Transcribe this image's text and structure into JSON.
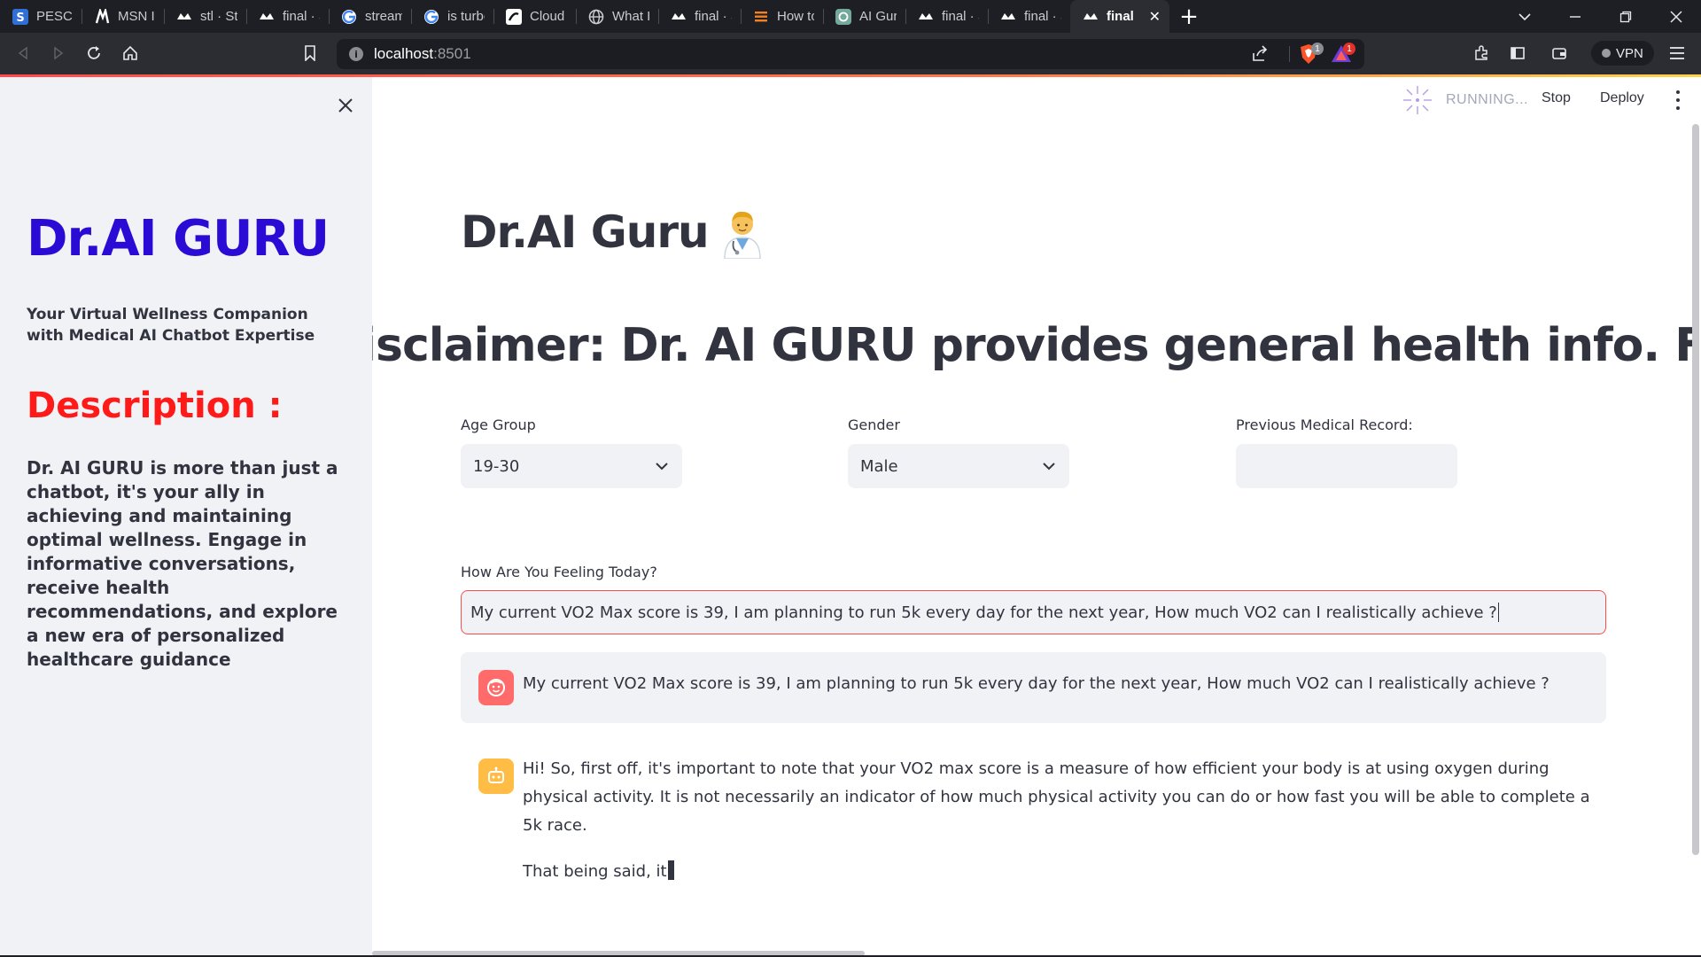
{
  "browser": {
    "tabs": [
      {
        "title": "PESCE Cap",
        "icon": "s-logo-icon",
        "active": false
      },
      {
        "title": "MSN India",
        "icon": "msn-icon",
        "active": false
      },
      {
        "title": "stl · Stream",
        "icon": "streamlit-icon",
        "active": false
      },
      {
        "title": "final · Stre",
        "icon": "streamlit-icon",
        "active": false
      },
      {
        "title": "stream lit",
        "icon": "google-icon",
        "active": false
      },
      {
        "title": "is turbo fa",
        "icon": "google-icon",
        "active": false
      },
      {
        "title": "Cloud App",
        "icon": "cloud-app-icon",
        "active": false
      },
      {
        "title": "What Is M",
        "icon": "globe-icon",
        "active": false
      },
      {
        "title": "final · Stre",
        "icon": "streamlit-icon",
        "active": false
      },
      {
        "title": "How to tra",
        "icon": "stackoverflow-icon",
        "active": false
      },
      {
        "title": "AI Guru Tr",
        "icon": "chatgpt-icon",
        "active": false
      },
      {
        "title": "final · Stre",
        "icon": "streamlit-icon",
        "active": false
      },
      {
        "title": "final · Stre",
        "icon": "streamlit-icon",
        "active": false
      },
      {
        "title": "final ·",
        "icon": "streamlit-icon",
        "active": true
      }
    ],
    "url_host": "localhost",
    "url_port": ":8501",
    "shield_count": "1",
    "alert_count": "1",
    "vpn_label": "VPN"
  },
  "sidebar": {
    "title": "Dr.AI GURU",
    "subtitle": "Your Virtual Wellness Companion with Medical AI Chatbot Expertise",
    "description_heading": "Description :",
    "description": "Dr. AI GURU is more than just a chatbot, it's your ally in achieving and maintaining optimal wellness. Engage in informative conversations, receive health recommendations, and explore a new era of personalized healthcare guidance"
  },
  "header": {
    "running_label": "RUNNING...",
    "stop_label": "Stop",
    "deploy_label": "Deploy"
  },
  "main": {
    "title": "Dr.AI Guru",
    "title_emoji": "doctor-emoji",
    "disclaimer": "Disclaimer: Dr. AI GURU provides general health info. For personal",
    "age_group": {
      "label": "Age Group",
      "value": "19-30"
    },
    "gender": {
      "label": "Gender",
      "value": "Male"
    },
    "medical_record": {
      "label": "Previous Medical Record:",
      "value": ""
    },
    "feeling": {
      "label": "How Are You Feeling Today?",
      "value": "My current VO2 Max score is 39, I am planning to run 5k every day for the next year, How much VO2 can I realistically achieve ?"
    },
    "messages": [
      {
        "role": "user",
        "text": "My current VO2 Max score is 39, I am planning to run 5k every day for the next year, How much VO2 can I realistically achieve ?"
      },
      {
        "role": "assistant",
        "paragraphs": [
          "Hi! So, first off, it's important to note that your VO2 max score is a measure of how efficient your body is at using oxygen during physical activity. It is not necessarily an indicator of how much physical activity you can do or how fast you will be able to complete a 5k race.",
          "That being said, it"
        ]
      }
    ]
  },
  "colors": {
    "brand_title": "#2a0bd6",
    "description_heading": "#ff1a1a",
    "input_focus_border": "#ff4b4b",
    "user_avatar": "#ff6b6b",
    "assistant_avatar": "#ffbd45",
    "sidebar_bg": "#f0f2f6"
  }
}
